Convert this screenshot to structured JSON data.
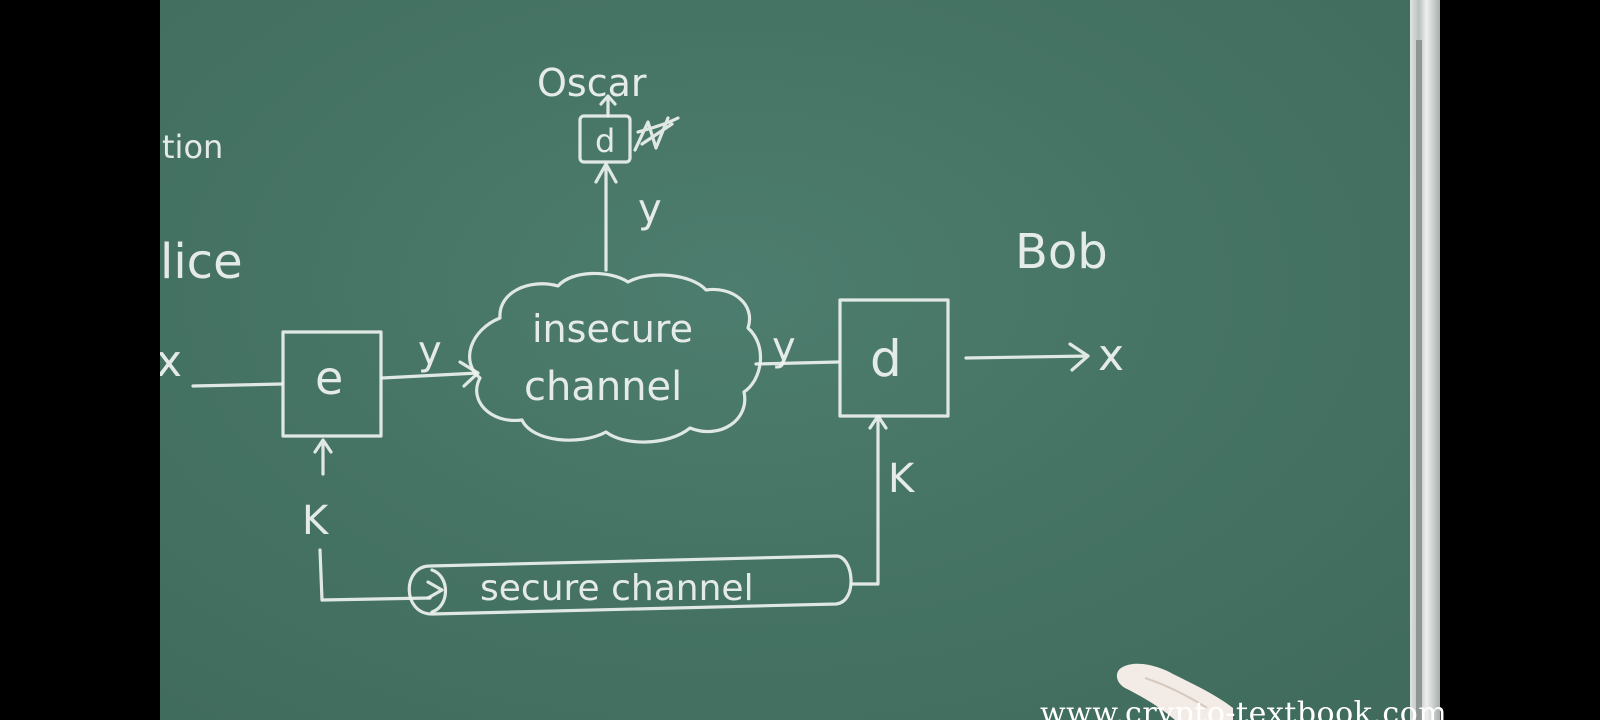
{
  "board": {
    "label_tion": "tion",
    "label_alice": "lice",
    "label_bob": "Bob",
    "label_oscar": "Oscar",
    "input_x": "x",
    "output_x": "x",
    "encrypt_box": "e",
    "decrypt_box": "d",
    "oscar_box": "d",
    "cipher_y_left": "y",
    "cipher_y_right": "y",
    "cipher_y_top": "y",
    "insecure_line1": "insecure",
    "insecure_line2": "channel",
    "secure_channel": "secure channel",
    "key_left": "K",
    "key_right": "K"
  },
  "colors": {
    "chalkboard": "#467464",
    "chalk": "#eef2ef"
  },
  "watermark": "www.crypto-textbook.com"
}
